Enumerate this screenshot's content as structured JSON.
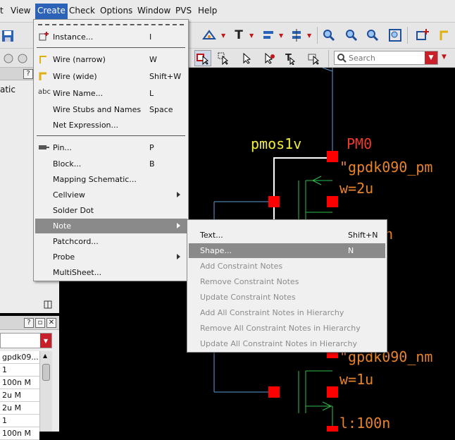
{
  "menubar": {
    "items": [
      "t",
      "View",
      "Create",
      "Check",
      "Options",
      "Window",
      "PVS",
      "Help"
    ]
  },
  "left_panel": {
    "title_fragment": "atic",
    "lower_combo_value": "",
    "properties": [
      "gpdk09...",
      "1",
      "100n M",
      "2u M",
      "2u M",
      "1",
      "100n M"
    ]
  },
  "toolbar": {
    "search_placeholder": "Search"
  },
  "create_menu": {
    "items": [
      {
        "label": "Instance...",
        "accel": "I",
        "icon": "instance-icon"
      },
      {
        "label": "Wire (narrow)",
        "accel": "W",
        "icon": "wire-narrow-icon"
      },
      {
        "label": "Wire (wide)",
        "accel": "Shift+W",
        "icon": "wire-wide-icon"
      },
      {
        "label": "Wire Name...",
        "accel": "L",
        "icon": "wire-name-icon",
        "icon_text": "abc"
      },
      {
        "label": "Wire Stubs and Names",
        "accel": "Space"
      },
      {
        "label": "Net Expression...",
        "accel": ""
      },
      {
        "label": "Pin...",
        "accel": "P",
        "icon": "pin-icon"
      },
      {
        "label": "Block...",
        "accel": "B"
      },
      {
        "label": "Mapping Schematic...",
        "accel": ""
      },
      {
        "label": "Cellview",
        "accel": "",
        "submenu": true
      },
      {
        "label": "Solder Dot",
        "accel": ""
      },
      {
        "label": "Note",
        "accel": "",
        "submenu": true,
        "highlighted": true
      },
      {
        "label": "Patchcord...",
        "accel": ""
      },
      {
        "label": "Probe",
        "accel": "",
        "submenu": true
      },
      {
        "label": "MultiSheet...",
        "accel": ""
      }
    ]
  },
  "note_menu": {
    "items": [
      {
        "label": "Text...",
        "accel": "Shift+N",
        "enabled": true
      },
      {
        "label": "Shape...",
        "accel": "N",
        "enabled": true,
        "highlighted": true
      },
      {
        "label": "Add Constraint Notes",
        "accel": "",
        "enabled": false
      },
      {
        "label": "Remove Constraint Notes",
        "accel": "",
        "enabled": false
      },
      {
        "label": "Update Constraint Notes",
        "accel": "",
        "enabled": false
      },
      {
        "label": "Add All Constraint Notes in Hierarchy",
        "accel": "",
        "enabled": false
      },
      {
        "label": "Remove All Constraint Notes in Hierarchy",
        "accel": "",
        "enabled": false
      },
      {
        "label": "Update All Constraint Notes in Hierarchy",
        "accel": "",
        "enabled": false
      }
    ]
  },
  "canvas": {
    "pmos_cell": "pmos1v",
    "pmos_instance": "PM0",
    "pmos_model": "\"gpdk090_pm",
    "pmos_width": "w=2u",
    "partial_label": "n",
    "nmos_model": "\"gpdk090_nm",
    "nmos_width": "w=1u",
    "nmos_length": "l:100n",
    "colors": {
      "background": "#000000",
      "wire": "#5b9bd8",
      "cell_label": "#f2ee3a",
      "instance_label": "#ee3a2a",
      "param_label": "#e8832a",
      "device": "#2dbf4a",
      "pin": "#ff0000",
      "selection": "#ffffff"
    }
  },
  "colors": {
    "menu_highlight": "#8a8a8a",
    "menubar_highlight": "#2c63b8",
    "dropdown_accent": "#c8202a"
  }
}
